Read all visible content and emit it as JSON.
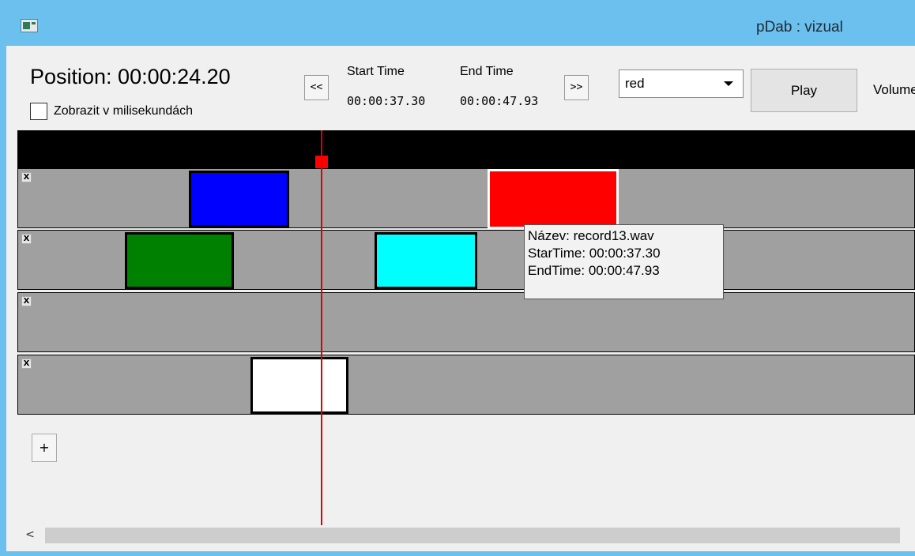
{
  "window": {
    "title": "pDab : vizual"
  },
  "toolbar": {
    "position": "Position: 00:00:24.20",
    "ms_checkbox_label": "Zobrazit v milisekundách",
    "ms_checked": false,
    "prev_label": "<<",
    "next_label": ">>",
    "start_time_label": "Start Time",
    "start_time_value": "00:00:37.30",
    "end_time_label": "End Time",
    "end_time_value": "00:00:47.93",
    "color_select_value": "red",
    "play_label": "Play",
    "volume_label": "Volume"
  },
  "tracks": [
    {
      "remove_label": "X",
      "clips": [
        {
          "color": "#0000ff"
        },
        {
          "color": "#ff0000",
          "selected": true
        }
      ]
    },
    {
      "remove_label": "X",
      "clips": [
        {
          "color": "#008000"
        },
        {
          "color": "#00ffff"
        }
      ]
    },
    {
      "remove_label": "X",
      "clips": []
    },
    {
      "remove_label": "X",
      "clips": [
        {
          "color": "#ffffff"
        }
      ]
    }
  ],
  "tooltip": {
    "name": "Název: record13.wav",
    "start": "StarTime: 00:00:37.30",
    "end": "EndTime: 00:00:47.93"
  },
  "add_track_label": "+",
  "scrollbar": {
    "left_arrow": "<"
  },
  "colors": {
    "playhead": "#e00000",
    "track_bg": "#a0a0a0",
    "timeline_bg": "#000000",
    "titlebar": "#6bc0ee"
  }
}
